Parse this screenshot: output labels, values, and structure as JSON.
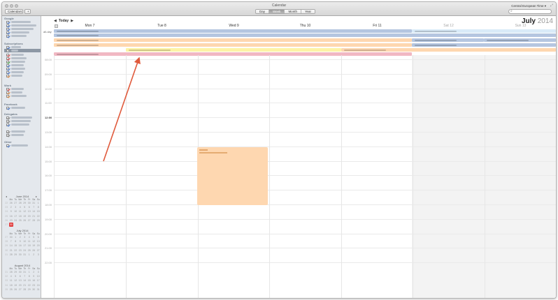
{
  "window": {
    "title": "Calendar"
  },
  "toolbar": {
    "calendars_label": "Calendars",
    "add_label": "+",
    "views": [
      "Day",
      "Week",
      "Month",
      "Year"
    ],
    "active_view": "Week",
    "timezone": "Central European Time ▾",
    "search_placeholder": ""
  },
  "header": {
    "month": "July",
    "year": "2014",
    "today_label": "Today",
    "all_day_label": "all-day",
    "days": [
      {
        "label": "Mon 7",
        "weekend": false
      },
      {
        "label": "Tue 8",
        "weekend": false
      },
      {
        "label": "Wed 9",
        "weekend": false
      },
      {
        "label": "Thu 10",
        "weekend": false
      },
      {
        "label": "Fri 11",
        "weekend": false
      },
      {
        "label": "Sat 12",
        "weekend": true
      },
      {
        "label": "Sun 13",
        "weekend": true
      }
    ]
  },
  "sidebar": {
    "sections": [
      "Google",
      "Subscriptions",
      "Work",
      "Facebook",
      "Delegates",
      "Other"
    ]
  },
  "hours": [
    "08:00",
    "09:00",
    "10:00",
    "11:00",
    "12:00",
    "13:00",
    "14:00",
    "15:00",
    "16:00",
    "17:00",
    "18:00",
    "19:00",
    "20:00",
    "21:00",
    "22:00"
  ],
  "mini_calendars": [
    {
      "title": "June 2014",
      "days": [
        "Mo",
        "Tu",
        "We",
        "Th",
        "Fr",
        "Sa",
        "Su"
      ],
      "weeks": [
        [
          "22",
          "26",
          "27",
          "28",
          "29",
          "30",
          "31",
          "1"
        ],
        [
          "23",
          "2",
          "3",
          "4",
          "5",
          "6",
          "7",
          "8"
        ],
        [
          "24",
          "9",
          "10",
          "11",
          "12",
          "13",
          "14",
          "15"
        ],
        [
          "25",
          "16",
          "17",
          "18",
          "19",
          "20",
          "21",
          "22"
        ],
        [
          "26",
          "23",
          "24",
          "25",
          "26",
          "27",
          "28",
          "29"
        ],
        [
          "27",
          "30",
          "",
          "",
          "",
          "",
          "",
          ""
        ]
      ]
    },
    {
      "title": "July 2014",
      "days": [
        "Mo",
        "Tu",
        "We",
        "Th",
        "Fr",
        "Sa",
        "Su"
      ],
      "weeks": [
        [
          "27",
          "30",
          "1",
          "2",
          "3",
          "4",
          "5",
          "6"
        ],
        [
          "28",
          "7",
          "8",
          "9",
          "10",
          "11",
          "12",
          "13"
        ],
        [
          "29",
          "14",
          "15",
          "16",
          "17",
          "18",
          "19",
          "20"
        ],
        [
          "30",
          "21",
          "22",
          "23",
          "24",
          "25",
          "26",
          "27"
        ],
        [
          "31",
          "28",
          "29",
          "30",
          "31",
          "1",
          "2",
          "3"
        ]
      ]
    },
    {
      "title": "August 2014",
      "days": [
        "Mo",
        "Tu",
        "We",
        "Th",
        "Fr",
        "Sa",
        "Su"
      ],
      "weeks": [
        [
          "31",
          "28",
          "29",
          "30",
          "31",
          "1",
          "2",
          "3"
        ],
        [
          "32",
          "4",
          "5",
          "6",
          "7",
          "8",
          "9",
          "10"
        ],
        [
          "33",
          "11",
          "12",
          "13",
          "14",
          "15",
          "16",
          "17"
        ],
        [
          "34",
          "18",
          "19",
          "20",
          "21",
          "22",
          "23",
          "24"
        ],
        [
          "35",
          "25",
          "26",
          "27",
          "28",
          "29",
          "30",
          "31"
        ]
      ]
    }
  ],
  "colors": {
    "blue_event": "#b5c6e0",
    "light_blue_event": "#d9ebf8",
    "orange_event": "#fed7b0",
    "yellow_event": "#fdf3a6",
    "red_event": "#f1b8c3",
    "annotation_arrow": "#e05a3c",
    "today_marker": "#e03b3b"
  }
}
